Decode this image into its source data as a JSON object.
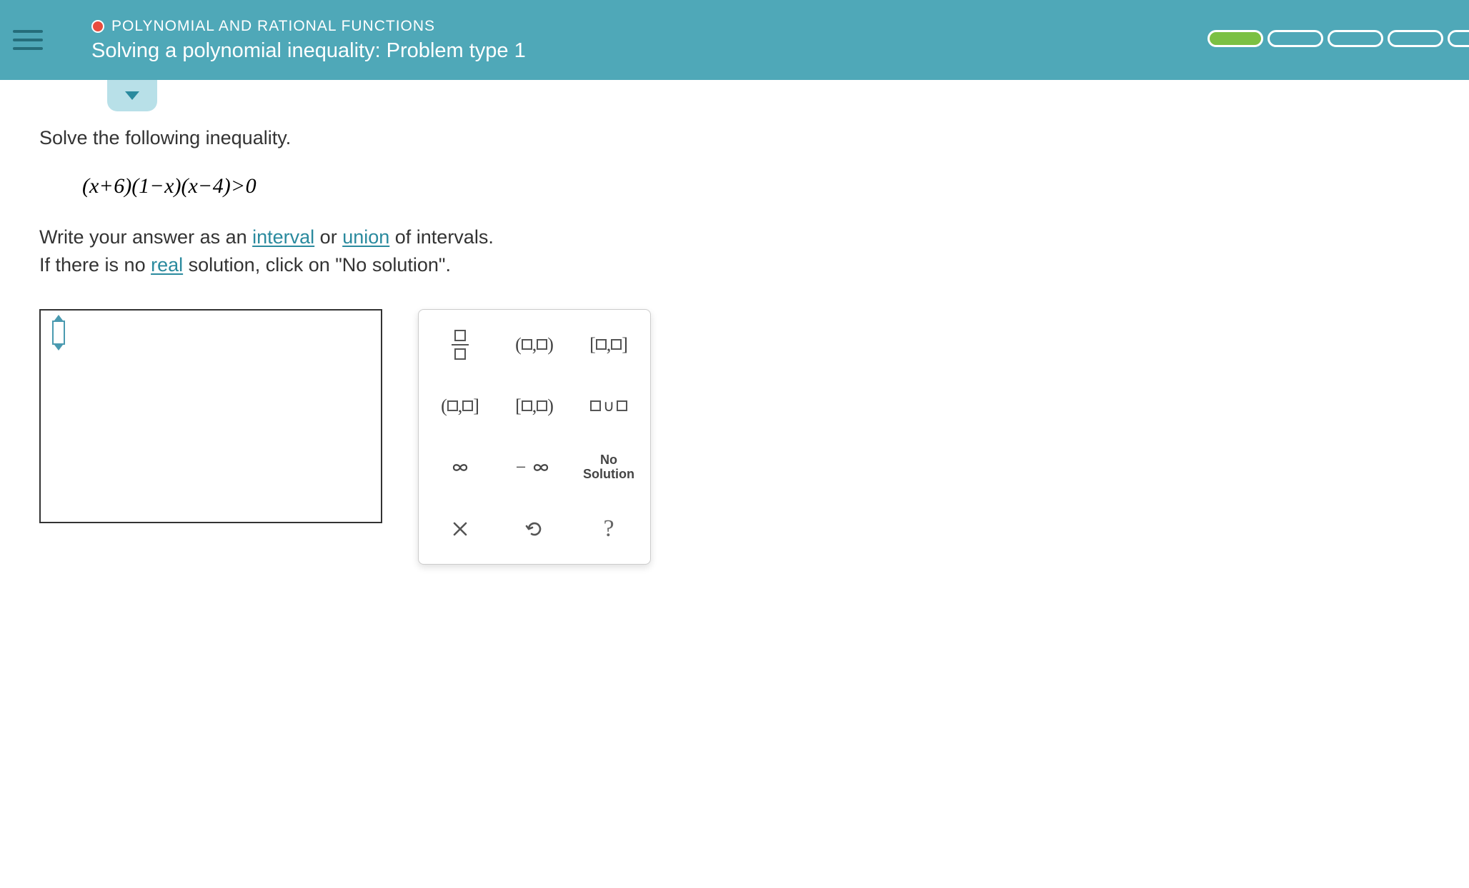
{
  "header": {
    "category": "POLYNOMIAL AND RATIONAL FUNCTIONS",
    "title": "Solving a polynomial inequality: Problem type 1",
    "progress_segments": 5,
    "progress_filled": 1
  },
  "problem": {
    "prompt": "Solve the following inequality.",
    "equation_parts": {
      "a": "(x + 6)",
      "b": "(1 − x)",
      "c": "(x − 4)",
      "rel": "> 0"
    },
    "instruction_pre": "Write your answer as an ",
    "link_interval": "interval",
    "instruction_mid1": " or ",
    "link_union": "union",
    "instruction_mid2": " of intervals.",
    "instruction_line2_pre": "If there is no ",
    "link_real": "real",
    "instruction_line2_post": " solution, click on \"No solution\"."
  },
  "keypad": {
    "fraction": "fraction",
    "open_open": "(▢,▢)",
    "closed_closed": "[▢,▢]",
    "open_closed": "(▢,▢]",
    "closed_open": "[▢,▢)",
    "union": "▢∪▢",
    "infinity": "∞",
    "neg_infinity": "−∞",
    "no_solution_l1": "No",
    "no_solution_l2": "Solution",
    "clear": "×",
    "undo": "↶",
    "help": "?"
  }
}
